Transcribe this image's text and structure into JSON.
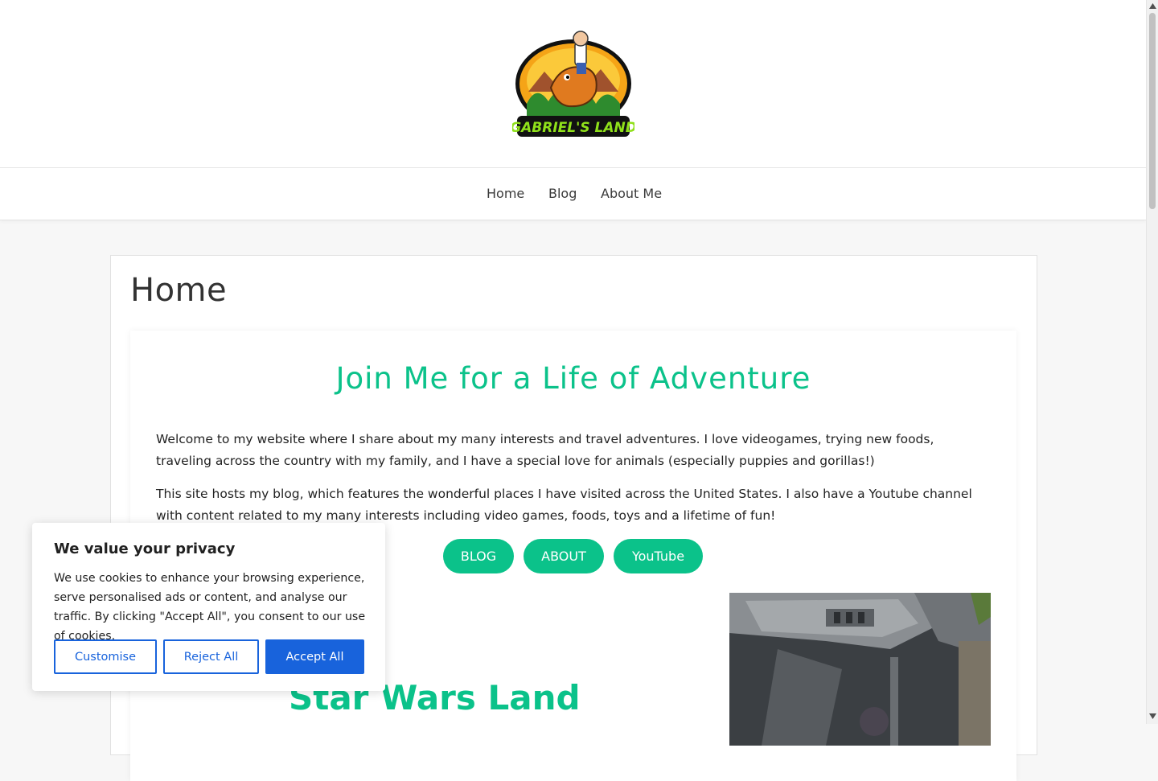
{
  "logo": {
    "alt": "GABRIEL'S LAND",
    "text": "GABRIEL'S LAND"
  },
  "nav": {
    "items": [
      {
        "label": "Home"
      },
      {
        "label": "Blog"
      },
      {
        "label": "About Me"
      }
    ]
  },
  "page": {
    "title": "Home"
  },
  "hero": {
    "title": "Join Me for a Life of Adventure",
    "paragraphs": [
      "Welcome to my website where I share about my many interests and travel adventures. I love videogames, trying new foods, traveling across the country with my family, and I have a special love for animals (especially puppies and gorillas!)",
      "This site hosts my blog, which features the wonderful places I have visited across the United States. I also have a Youtube channel with content related to my many interests including video games, foods, toys and a lifetime of fun!"
    ],
    "buttons": [
      {
        "label": "BLOG"
      },
      {
        "label": "ABOUT"
      },
      {
        "label": "YouTube"
      }
    ]
  },
  "section": {
    "title": "Star Wars Land"
  },
  "cookie": {
    "title": "We value your privacy",
    "text": "We use cookies to enhance your browsing experience, serve personalised ads or content, and analyse our traffic. By clicking \"Accept All\", you consent to our use of cookies.",
    "customise_label": "Customise",
    "reject_label": "Reject All",
    "accept_label": "Accept All"
  },
  "colors": {
    "accent": "#0bc28a",
    "cookie_blue": "#1863dc",
    "text": "#222222",
    "background": "#f7f7f7"
  }
}
